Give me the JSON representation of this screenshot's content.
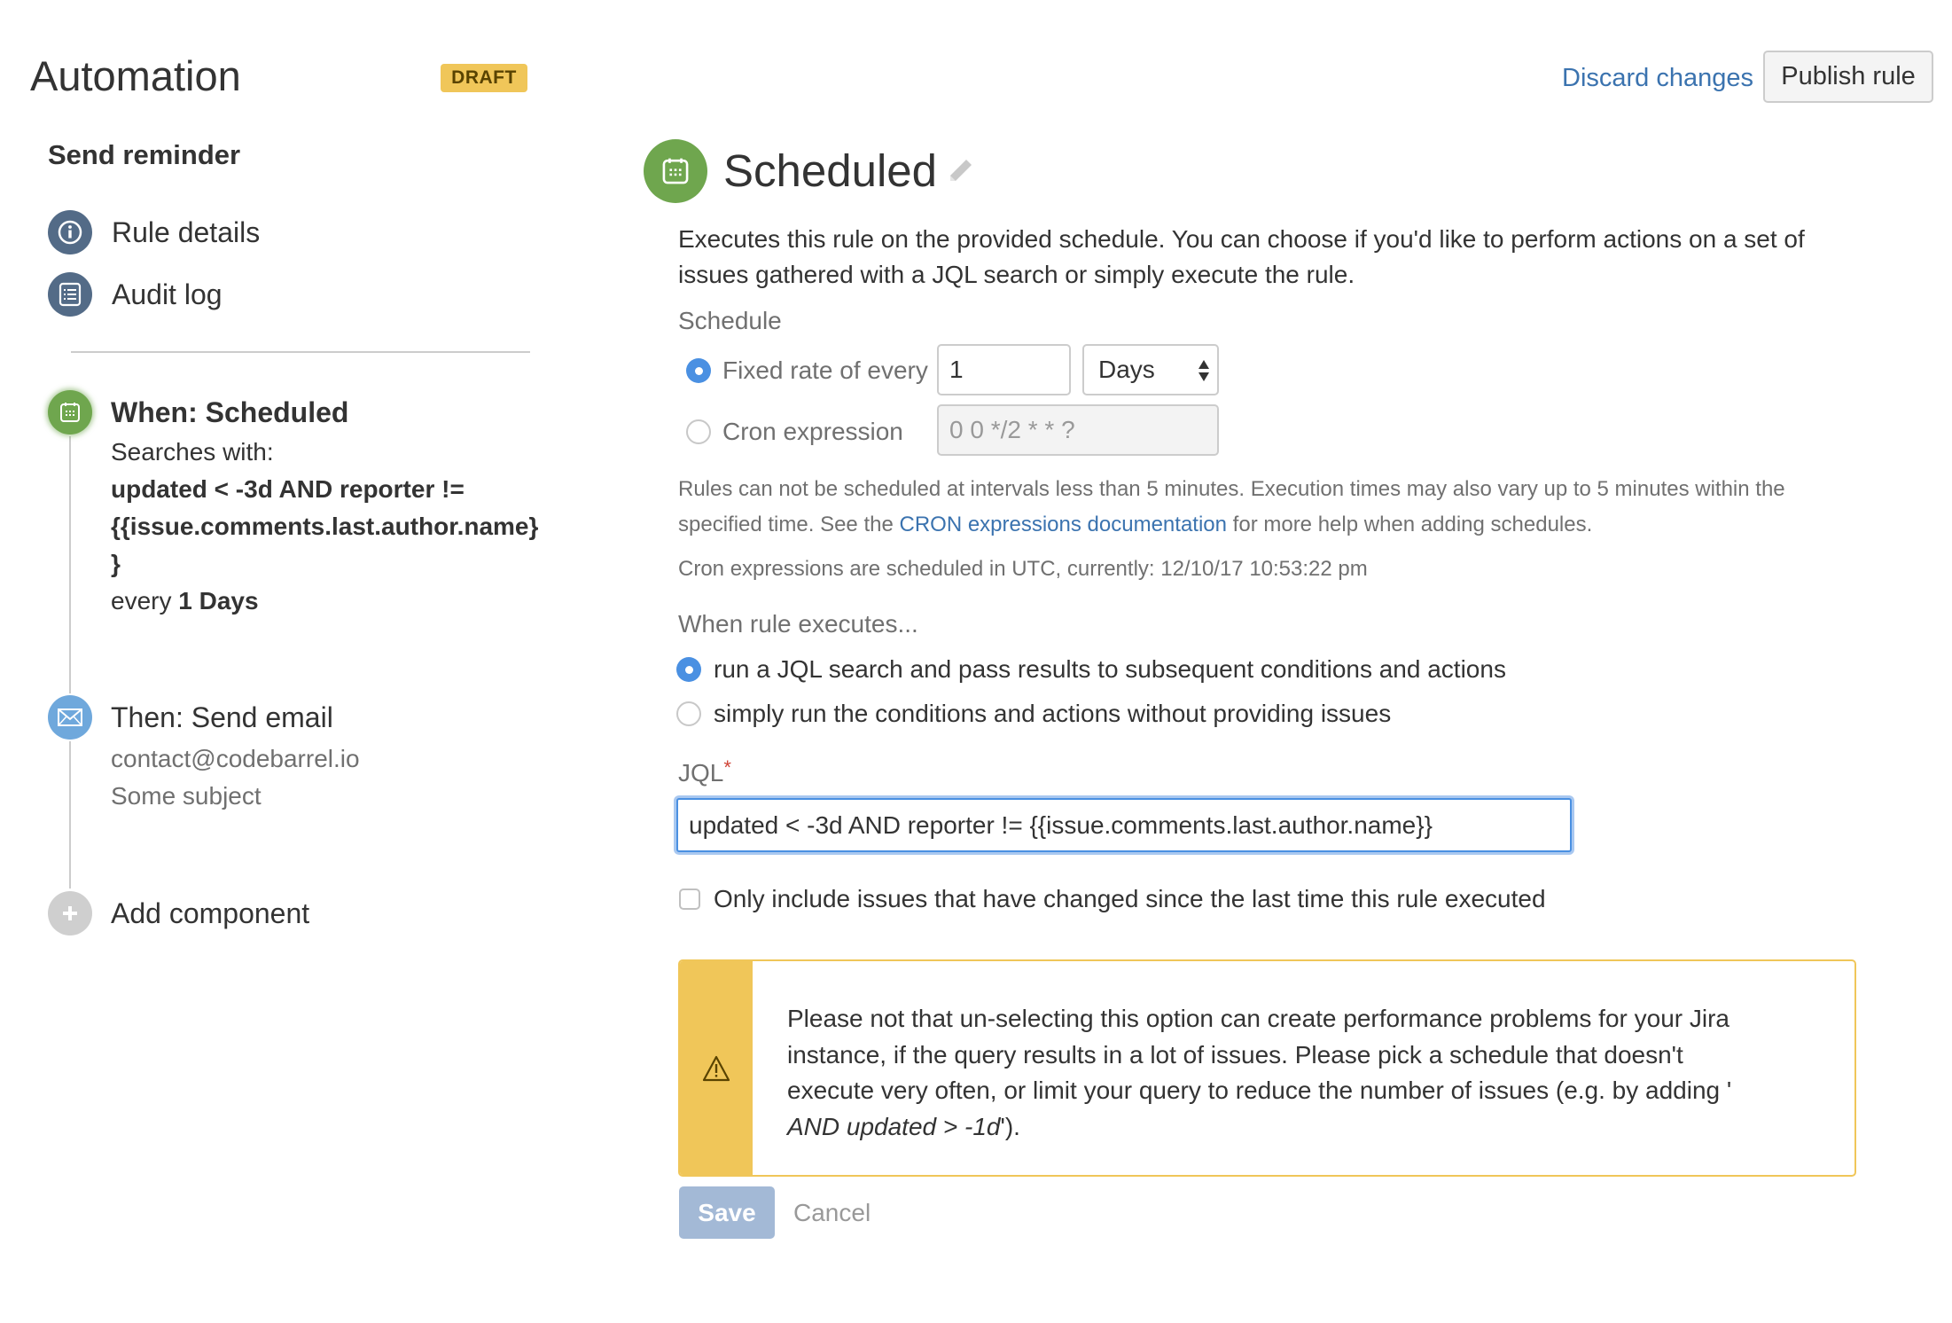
{
  "header": {
    "title": "Automation",
    "status_badge": "DRAFT",
    "discard_label": "Discard changes",
    "publish_label": "Publish rule"
  },
  "sidebar": {
    "rule_name": "Send reminder",
    "nav": [
      {
        "label": "Rule details",
        "icon": "info-icon"
      },
      {
        "label": "Audit log",
        "icon": "list-icon"
      }
    ],
    "steps": {
      "trigger": {
        "title": "When: Scheduled",
        "searches_label": "Searches with:",
        "jql_line1": "updated < -3d AND reporter !=",
        "jql_line2": "{{issue.comments.last.author.name}",
        "jql_line3": "}",
        "every_prefix": "every",
        "every_value": "1 Days",
        "icon": "calendar-icon"
      },
      "action": {
        "title": "Then: Send email",
        "recipient": "contact@codebarrel.io",
        "subject": "Some subject",
        "icon": "mail-icon"
      },
      "add_label": "Add component"
    }
  },
  "main": {
    "title": "Scheduled",
    "description_line1": "Executes this rule on the provided schedule. You can choose if you'd like to perform actions on a set of",
    "description_line2": "issues gathered with a JQL search or simply execute the rule.",
    "schedule_label": "Schedule",
    "fixed_rate": {
      "label": "Fixed rate of every",
      "selected": true,
      "value": "1",
      "unit": "Days"
    },
    "cron": {
      "label": "Cron expression",
      "selected": false,
      "placeholder": "0 0 */2 * * ?"
    },
    "help": {
      "line1": "Rules can not be scheduled at intervals less than 5 minutes. Execution times may also vary up to 5 minutes within the",
      "line2_prefix": "specified time. See the",
      "line2_link": "CRON expressions documentation",
      "line2_suffix": "for more help when adding schedules.",
      "utc_note": "Cron expressions are scheduled in UTC, currently: 12/10/17 10:53:22 pm"
    },
    "when_executes_label": "When rule executes...",
    "execution_options": [
      {
        "label": "run a JQL search and pass results to subsequent conditions and actions",
        "selected": true
      },
      {
        "label": "simply run the conditions and actions without providing issues",
        "selected": false
      }
    ],
    "jql_label": "JQL",
    "jql_required_mark": "*",
    "jql_value": "updated < -3d AND reporter != {{issue.comments.last.author.name}}",
    "only_changed_label": "Only include issues that have changed since the last time this rule executed",
    "only_changed_checked": false,
    "warning": {
      "line1": "Please not that un-selecting this option can create performance problems for your Jira",
      "line2": "instance, if the query results in a lot of issues. Please pick a schedule that doesn't",
      "line3": "execute very often, or limit your query to reduce the number of issues (e.g. by adding '",
      "line4_italic": "AND updated > -1d",
      "line4_suffix": "').",
      "icon": "warning-icon"
    },
    "save_label": "Save",
    "cancel_label": "Cancel"
  },
  "colors": {
    "accent_blue": "#3b73af",
    "focus_blue": "#4a90e2",
    "trigger_green": "#6fa64e",
    "action_blue": "#6fa8dc",
    "nav_slate": "#536b87",
    "draft_yellow": "#f0c659",
    "save_disabled": "#a3b9d6"
  }
}
